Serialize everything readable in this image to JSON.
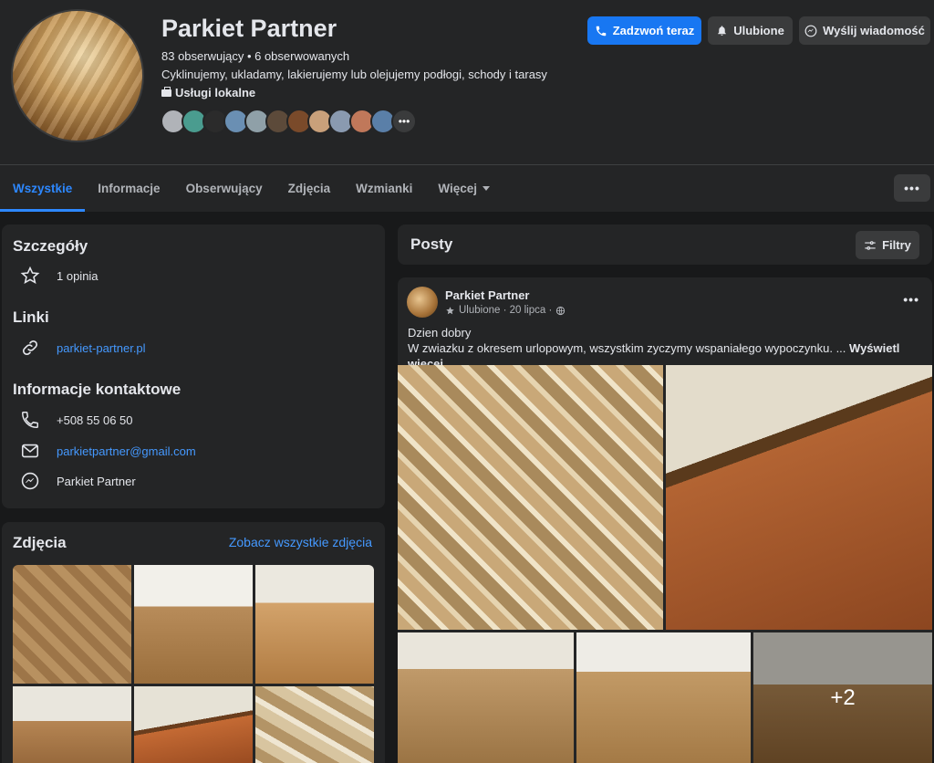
{
  "header": {
    "page_name": "Parkiet Partner",
    "followers": "83 obserwujący • 6 obserwowanych",
    "description": "Cyklinujemy, ukladamy, lakierujemy lub olejujemy podłogi, schody i tarasy",
    "category": "Usługi lokalne",
    "buttons": {
      "call": "Zadzwoń teraz",
      "follow": "Ulubione",
      "message": "Wyślij wiadomość"
    },
    "avatar_colors": [
      "#b0b3b8",
      "#4a9c8f",
      "#2b2b2b",
      "#6a8fb3",
      "#8fa0a8",
      "#5c4a3a",
      "#7a4a2a",
      "#c9a07a",
      "#8a9ab0",
      "#c0785a",
      "#5a7fa8",
      "#3a3b3c"
    ]
  },
  "tabs": [
    "Wszystkie",
    "Informacje",
    "Obserwujący",
    "Zdjęcia",
    "Wzmianki",
    "Więcej"
  ],
  "more_menu_glyph": "•••",
  "details": {
    "title": "Szczegóły",
    "rating": "1 opinia"
  },
  "links": {
    "title": "Linki",
    "website": "parkiet-partner.pl"
  },
  "contact": {
    "title": "Informacje kontaktowe",
    "phone": "+508 55 06 50",
    "email": "parkietpartner@gmail.com",
    "messenger": "Parkiet Partner"
  },
  "photos": {
    "title": "Zdjęcia",
    "see_all": "Zobacz wszystkie zdjęcia"
  },
  "posts": {
    "title": "Posty",
    "filters": "Filtry",
    "post": {
      "author": "Parkiet Partner",
      "meta": "Ulubione · 20 lipca ·",
      "line1": "Dzien dobry",
      "line2": "W zwiazku z okresem urlopowym, wszystkim zyczymy wspaniałego wypoczynku. ...",
      "see_more": "Wyświetl więcej",
      "extra_photos": "+2"
    }
  },
  "accent_color": "#2d88ff"
}
